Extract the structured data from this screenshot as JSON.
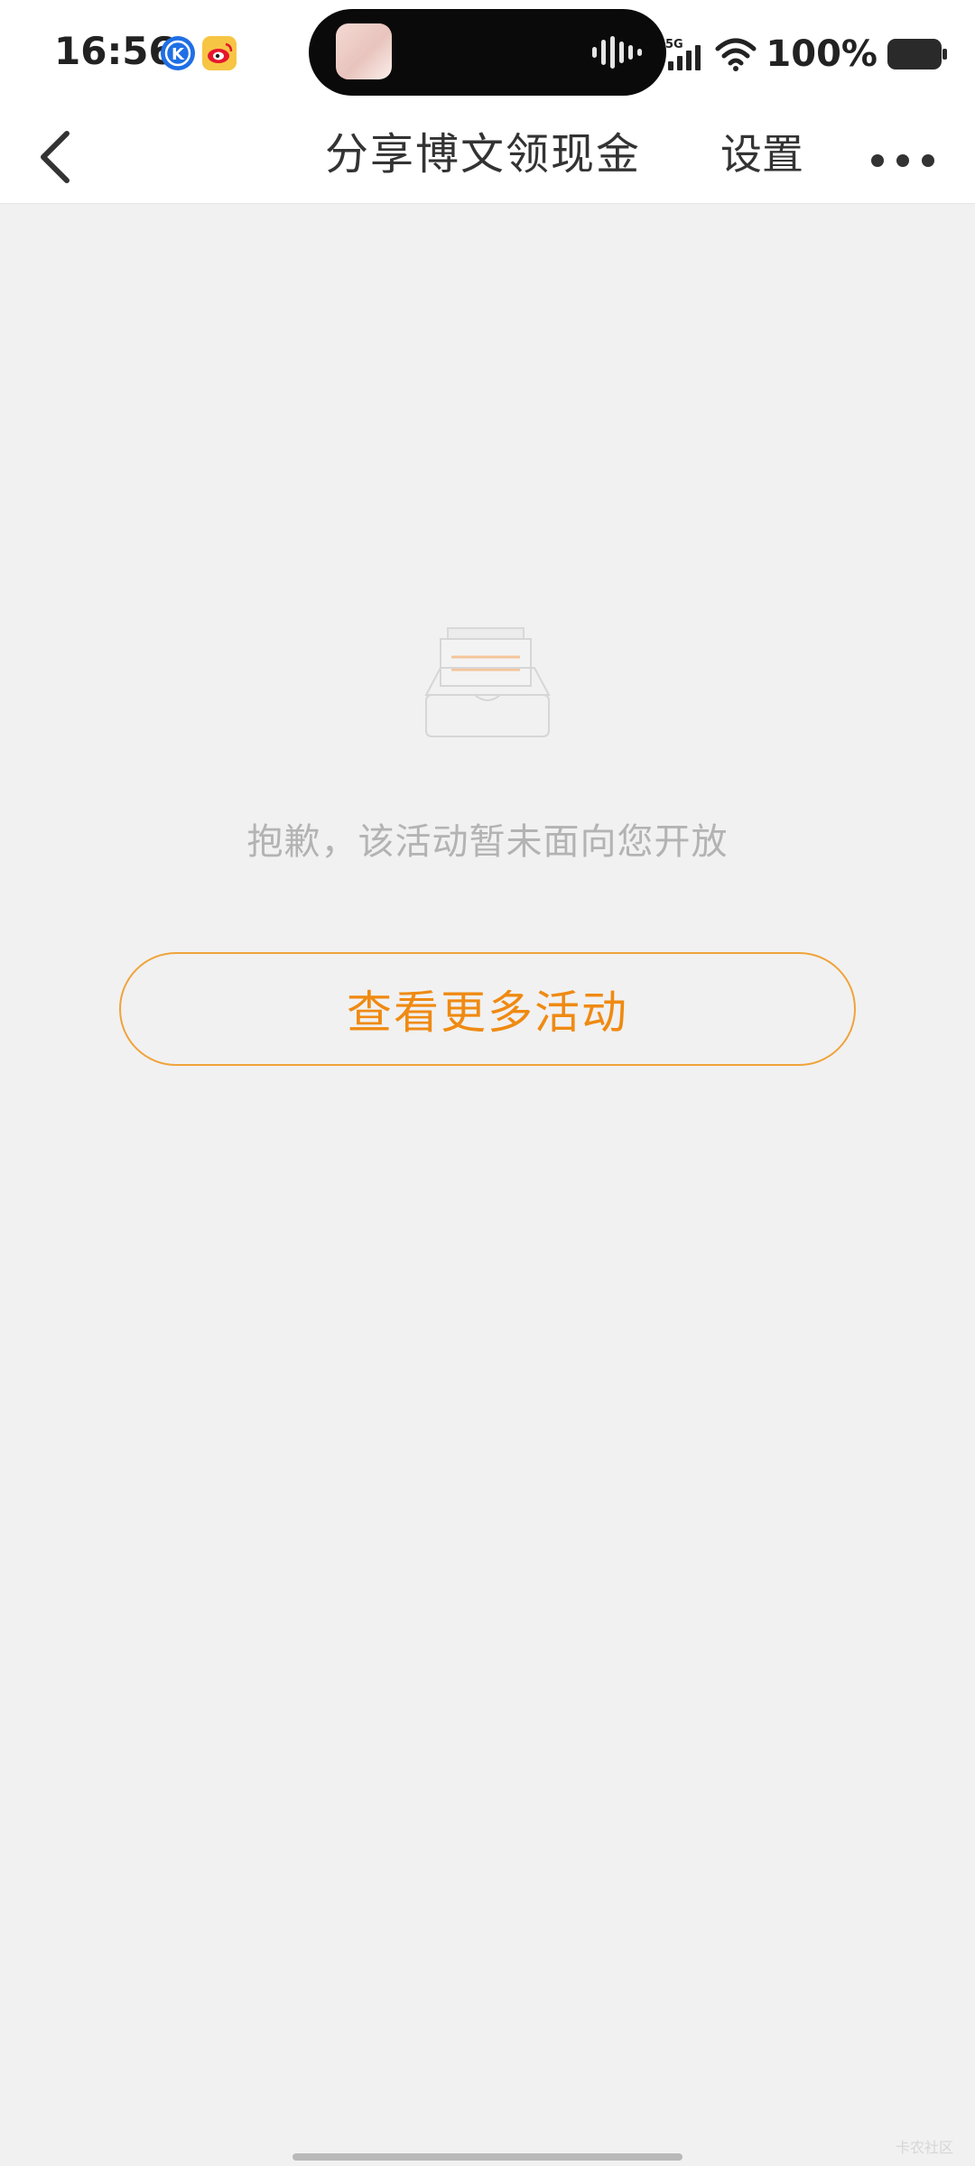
{
  "status_bar": {
    "time": "16:56",
    "network": "5G",
    "battery": "100%",
    "icons": [
      "k-app-icon",
      "weibo-icon"
    ]
  },
  "nav": {
    "title": "分享博文领现金",
    "settings_label": "设置",
    "back_icon": "chevron-left-icon",
    "more_icon": "more-dots-icon"
  },
  "empty_state": {
    "icon": "empty-inbox-icon",
    "message": "抱歉，该活动暂未面向您开放",
    "button_label": "查看更多活动"
  },
  "watermark": "卡农社区",
  "colors": {
    "accent": "#ef8a12",
    "accent_border": "#f0a33a",
    "background": "#f1f1f1",
    "message_text": "#b3b3b3"
  }
}
